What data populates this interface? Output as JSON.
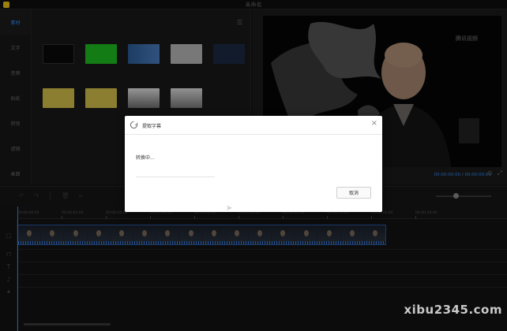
{
  "titlebar": {
    "title": "未命名",
    "menu": [
      "",
      "",
      "",
      ""
    ],
    "right": [
      "",
      "",
      ""
    ]
  },
  "leftnav": {
    "items": [
      {
        "label": "素材",
        "active": true
      },
      {
        "label": "文字"
      },
      {
        "label": "音频"
      },
      {
        "label": "贴纸"
      },
      {
        "label": "转场"
      },
      {
        "label": "滤镜"
      },
      {
        "label": "画面"
      }
    ]
  },
  "media": {
    "tabs": [
      "",
      "",
      "",
      ""
    ],
    "subtabs": [
      {
        "label": "",
        "active": true
      },
      {
        "label": ""
      },
      {
        "label": ""
      },
      {
        "label": ""
      }
    ],
    "thumbs": [
      {
        "caption": "",
        "color": "#0a0a0a"
      },
      {
        "caption": "",
        "color": "#1fbf1f"
      },
      {
        "caption": "",
        "color": "#2d5d9a"
      },
      {
        "caption": "",
        "color": "#b8b8b8"
      },
      {
        "caption": "",
        "color": "#1c2a44"
      },
      {
        "caption": "",
        "color": "#d6c24a"
      },
      {
        "caption": "",
        "color": "#d6c24a"
      },
      {
        "caption": "",
        "color": "#9a9a9a"
      },
      {
        "caption": "",
        "color": "#cfcfcf"
      }
    ]
  },
  "preview": {
    "watermark": "腾讯视频",
    "time_current": "00:00:00:00",
    "time_sep": " / ",
    "time_total": "00:00:00:00"
  },
  "timeline": {
    "ticks": [
      "00:00:00:00",
      "00:00:02:00",
      "00:00:04:00",
      "00:00:06:00",
      "00:00:08:00",
      "00:00:10:00",
      "00:00:12:00",
      "00:00:14:00",
      "00:00:16:00",
      "00:00:18:00"
    ],
    "clip_label": "",
    "zoom": 0.35
  },
  "dialog": {
    "title": "提取字幕",
    "status": "转换中...",
    "progress": 0.0,
    "cancel_label": "取消",
    "close_glyph": "×"
  },
  "site_watermark": "xibu2345.com"
}
